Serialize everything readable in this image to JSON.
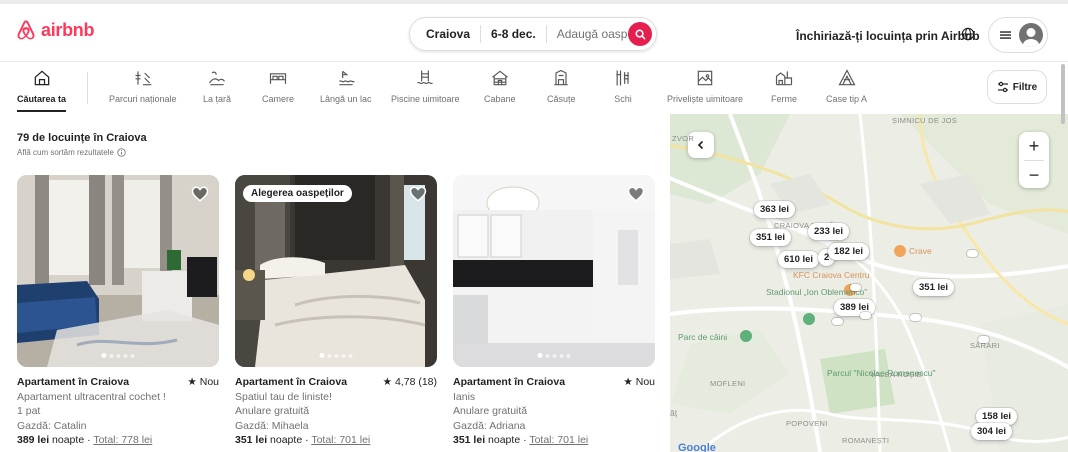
{
  "brand": {
    "name": "airbnb",
    "color": "#FF385C"
  },
  "search": {
    "location": "Craiova",
    "dates": "6-8 dec.",
    "guests_placeholder": "Adaugă oaspeți",
    "search_icon": "search-icon"
  },
  "header": {
    "host_link": "Închiriază-ți locuința prin Airbnb",
    "globe_icon": "globe-icon",
    "menu_icon": "hamburger-icon",
    "avatar_icon": "user-avatar-icon"
  },
  "categories": [
    {
      "label": "Căutarea ta",
      "icon": "home-search-icon",
      "active": true
    },
    {
      "label": "Parcuri naționale",
      "icon": "national-park-icon"
    },
    {
      "label": "La țară",
      "icon": "countryside-icon"
    },
    {
      "label": "Camere",
      "icon": "bed-room-icon"
    },
    {
      "label": "Lângă un lac",
      "icon": "lake-icon"
    },
    {
      "label": "Piscine uimitoare",
      "icon": "pool-icon"
    },
    {
      "label": "Cabane",
      "icon": "cabin-icon"
    },
    {
      "label": "Căsuțe",
      "icon": "tiny-house-icon"
    },
    {
      "label": "Schi",
      "icon": "ski-icon"
    },
    {
      "label": "Priveliște uimitoare",
      "icon": "view-icon"
    },
    {
      "label": "Ferme",
      "icon": "farm-icon"
    },
    {
      "label": "Case tip A",
      "icon": "a-frame-icon"
    }
  ],
  "filters_label": "Filtre",
  "results": {
    "count_text": "79 de locuințe în Craiova",
    "sort_note": "Află cum sortăm rezultatele"
  },
  "listings": [
    {
      "title": "Apartament în Craiova",
      "rating": "★ Nou",
      "line1": "Apartament ultracentral cochet !",
      "line2": "1 pat",
      "host": "Gazdă: Catalin",
      "price": "389 lei",
      "price_suffix": " noapte · ",
      "total": "Total: 778 lei",
      "badge": "",
      "photo_count": 5
    },
    {
      "title": "Apartament în Craiova",
      "rating": "★ 4,78 (18)",
      "line1": "Spatiul tau de liniste!",
      "line2": "Anulare gratuită",
      "host": "Gazdă: Mihaela",
      "price": "351 lei",
      "price_suffix": " noapte · ",
      "total": "Total: 701 lei",
      "badge": "Alegerea oaspeților",
      "photo_count": 5
    },
    {
      "title": "Apartament în Craiova",
      "rating": "★ Nou",
      "line1": "Ianis",
      "line2": "Anulare gratuită",
      "host": "Gazdă: Adriana",
      "price": "351 lei",
      "price_suffix": " noapte · ",
      "total": "Total: 701 lei",
      "badge": "",
      "photo_count": 5
    }
  ],
  "map": {
    "zoom_in": "+",
    "zoom_out": "−",
    "pins": [
      "363 lei",
      "351 lei",
      "233 lei",
      "610 lei",
      "2",
      "182 lei",
      "389 lei",
      "351 lei",
      "158 lei",
      "304 lei"
    ],
    "labels": {
      "simnicu": "ȘIMNICU DE JOS",
      "zvor": "ZVOR",
      "craiova_noua": "CRAIOVA NOUĂ",
      "crave": "Crave",
      "kfc": "KFC Craiova Centru",
      "stadion": "Stadionul „Ion Oblemenco”",
      "parc_caini": "Parc de câini",
      "mofleni": "MOFLENI",
      "sarari": "SĂRARI",
      "valea_rosie": "VALEA ROȘIE",
      "parc_romanescu": "Parcul \"Nicolae Romanescu\"",
      "popoveni": "POPOVENI",
      "romanesti": "ROMANEȘTI",
      "at": "ăț"
    },
    "google_logo": "Google"
  }
}
